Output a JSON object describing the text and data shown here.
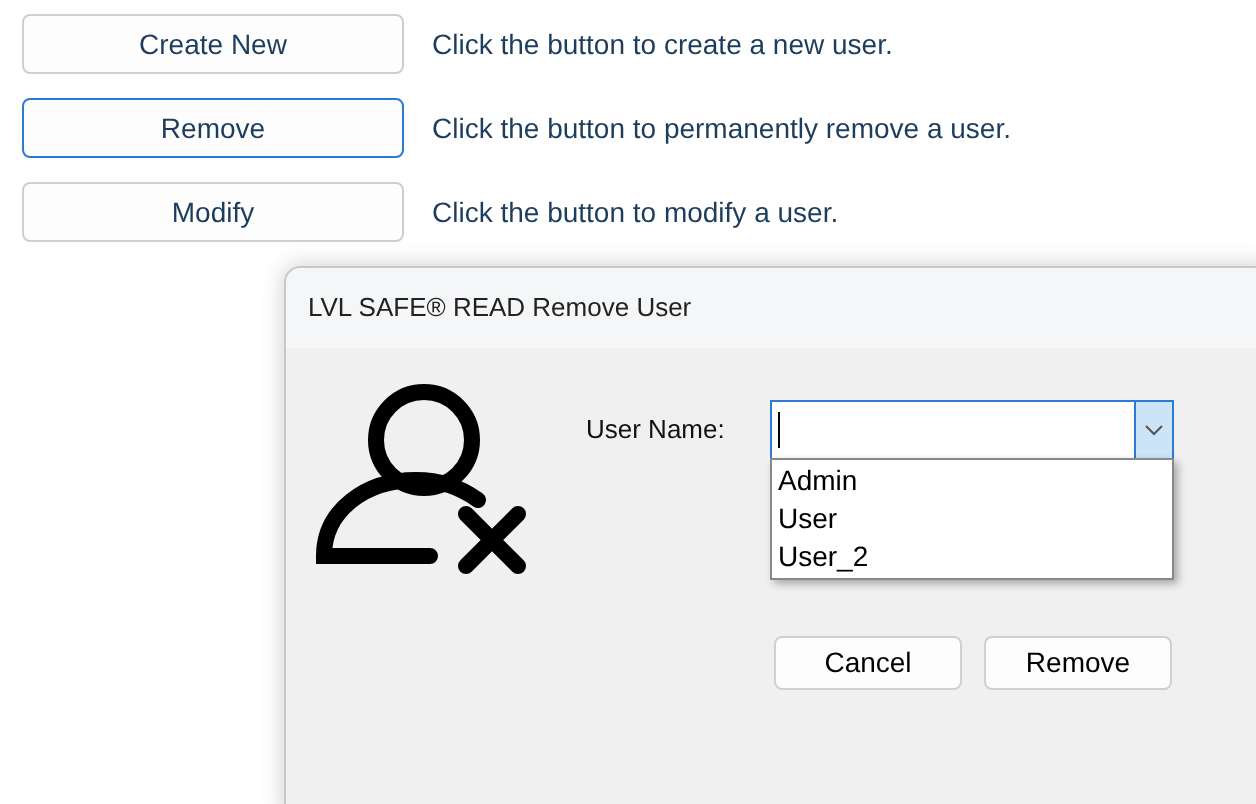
{
  "actions": [
    {
      "label": "Create New",
      "focused": false,
      "description": "Click the button to create a new user."
    },
    {
      "label": "Remove",
      "focused": true,
      "description": "Click the button to permanently remove a user."
    },
    {
      "label": "Modify",
      "focused": false,
      "description": "Click the button to modify a user."
    }
  ],
  "dialog": {
    "title": "LVL SAFE® READ Remove User",
    "user_name": {
      "label": "User Name:",
      "expanded": true,
      "options": [
        "Admin",
        "User",
        "User_2"
      ]
    },
    "buttons": [
      "Cancel",
      "Remove"
    ]
  }
}
